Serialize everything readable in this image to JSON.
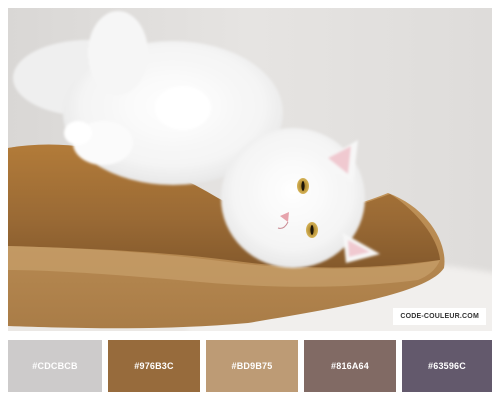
{
  "image": {
    "subject": "cat-on-pillow",
    "brand": "CODE-COULEUR.COM"
  },
  "palette": {
    "swatches": [
      {
        "label": "#CDCBCB",
        "color": "#CDCBCB"
      },
      {
        "label": "#976B3C",
        "color": "#976B3C"
      },
      {
        "label": "#BD9B75",
        "color": "#BD9B75"
      },
      {
        "label": "#816A64",
        "color": "#816A64"
      },
      {
        "label": "#63596C",
        "color": "#63596C"
      }
    ]
  }
}
